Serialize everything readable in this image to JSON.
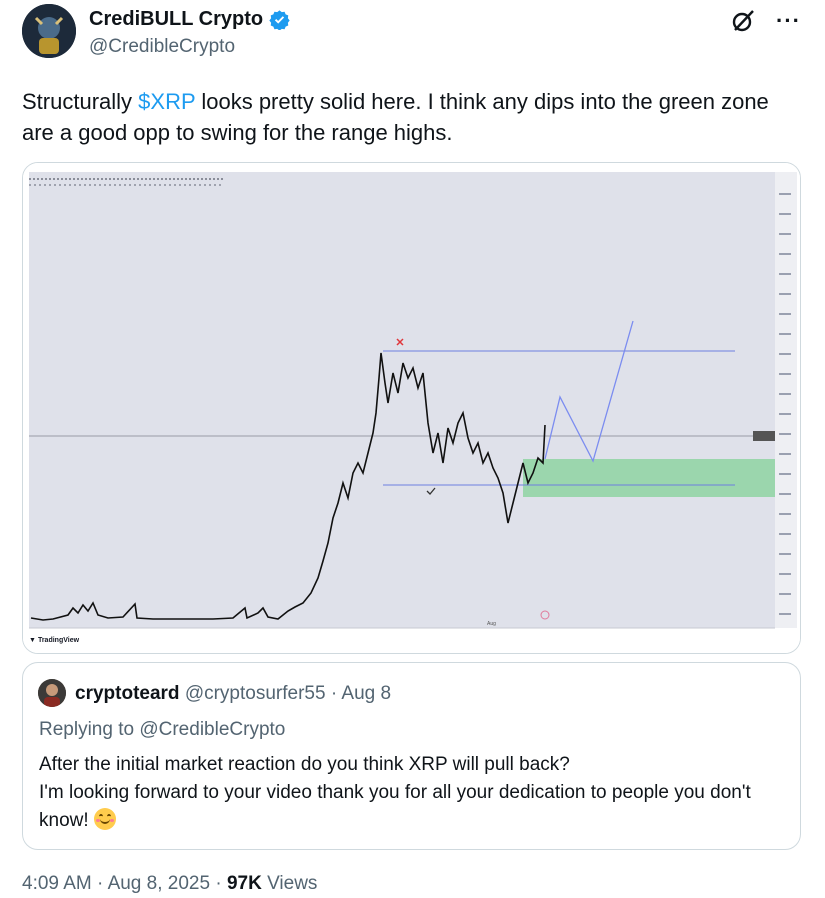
{
  "author": {
    "name": "CrediBULL Crypto",
    "handle": "@CredibleCrypto"
  },
  "tweet": {
    "text_before": "Structurally ",
    "cashtag": "$XRP",
    "text_after": " looks pretty solid here. I think any dips into the green zone are a good opp to swing for the range highs."
  },
  "chart": {
    "watermark": "TradingView",
    "x_ticks": [
      "Aug"
    ],
    "colors": {
      "background": "#dfe1ea",
      "candles": "#111111",
      "level_lines": "#6d7ee0",
      "projection": "#7b8cf0",
      "zone": "#8fd4a2",
      "cross_marker": "#e0363b"
    },
    "markers": [
      "cross",
      "check"
    ]
  },
  "quote": {
    "name": "cryptoteard",
    "handle": "@cryptosurfer55",
    "separator": " · ",
    "date": "Aug 8",
    "replying_prefix": "Replying to ",
    "replying_handle": "@CredibleCrypto",
    "line1": "After the initial market reaction do you think XRP will pull back?",
    "line2": "I'm looking forward to your video thank you for all your dedication to people you don't know! "
  },
  "footer": {
    "time": "4:09 AM",
    "sep1": " · ",
    "date": "Aug 8, 2025",
    "sep2": " · ",
    "views_count": "97K",
    "views_label": " Views"
  }
}
